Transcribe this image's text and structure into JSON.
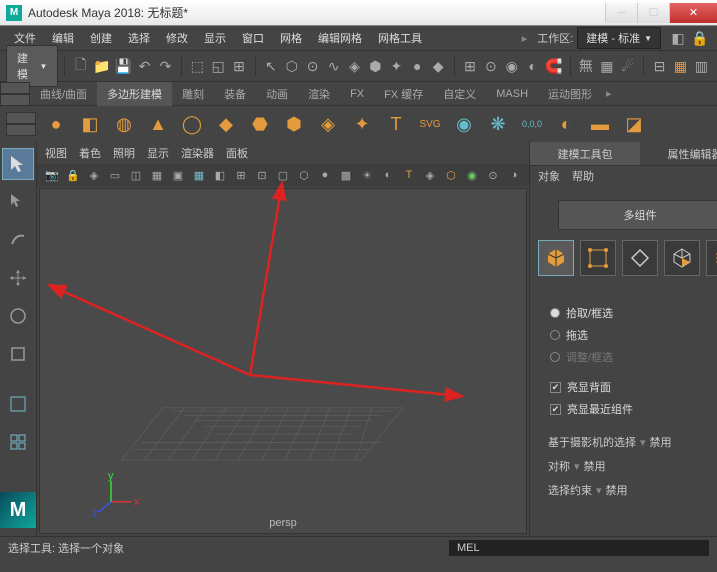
{
  "title": "Autodesk Maya 2018: 无标题*",
  "menu": [
    "文件",
    "编辑",
    "创建",
    "选择",
    "修改",
    "显示",
    "窗口",
    "网格",
    "编辑网格",
    "网格工具"
  ],
  "workspace": {
    "label": "工作区:",
    "value": "建模 - 标准"
  },
  "topbar": {
    "module": "建模"
  },
  "shelf_tabs": [
    "曲线/曲面",
    "多边形建模",
    "雕刻",
    "装备",
    "动画",
    "渲染",
    "FX",
    "FX 缓存",
    "自定义",
    "MASH",
    "运动图形"
  ],
  "viewport_menu": [
    "视图",
    "着色",
    "照明",
    "显示",
    "渲染器",
    "面板"
  ],
  "viewport_label": "persp",
  "right_panel": {
    "tabs": [
      "建模工具包",
      "属性编辑器"
    ],
    "submenu": [
      "对象",
      "帮助"
    ],
    "multi_component": "多组件",
    "radios": {
      "pick": "拾取/框选",
      "drag": "拖选",
      "tweak": "调整/框选"
    },
    "checks": {
      "backface": "亮显背面",
      "nearest": "亮显最近组件"
    },
    "camera_select": {
      "label": "基于摄影机的选择",
      "value": "禁用"
    },
    "symmetry": {
      "label": "对称",
      "value": "禁用"
    },
    "constraint": {
      "label": "选择约束",
      "value": "禁用"
    }
  },
  "status": {
    "left": "选择工具: 选择一个对象",
    "mel": "MEL"
  }
}
